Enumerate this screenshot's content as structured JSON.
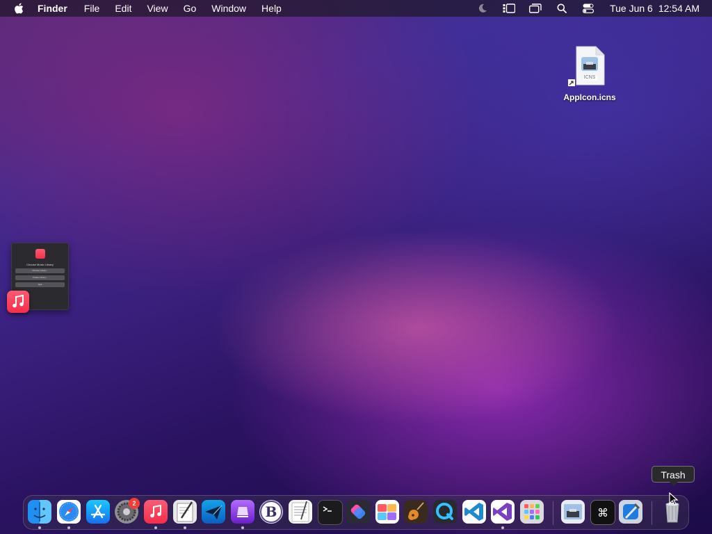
{
  "menubar": {
    "apple_icon": "apple-logo-icon",
    "app_name": "Finder",
    "menus": [
      "File",
      "Edit",
      "View",
      "Go",
      "Window",
      "Help"
    ],
    "status_icons": [
      "focus-moon-icon",
      "stage-manager-icon",
      "screen-mirroring-icon",
      "spotlight-search-icon",
      "control-center-icon"
    ],
    "clock": {
      "date": "Tue Jun 6",
      "time": "12:54 AM"
    }
  },
  "desktop": {
    "file": {
      "name": "AppIcon.icns",
      "badge": "ICNS",
      "alias": true
    }
  },
  "music_dialog_thumbnail": {
    "title": "Choose Music Library",
    "buttons": [
      "Choose Library...",
      "Create Library...",
      "Quit"
    ]
  },
  "dock": {
    "apps": [
      {
        "name": "Finder",
        "icon": "finder-icon",
        "running": true
      },
      {
        "name": "Safari",
        "icon": "safari-icon",
        "running": true
      },
      {
        "name": "App Store",
        "icon": "app-store-icon",
        "running": false
      },
      {
        "name": "System Settings",
        "icon": "settings-gear-icon",
        "running": false,
        "badge": "2"
      },
      {
        "name": "Music",
        "icon": "music-icon",
        "running": true
      },
      {
        "name": "Script Editor",
        "icon": "script-editor-icon",
        "running": true
      },
      {
        "name": "Mail Client",
        "icon": "paper-plane-icon",
        "running": false
      },
      {
        "name": "Archiver",
        "icon": "purple-app-icon",
        "running": true
      },
      {
        "name": "BBEdit",
        "icon": "bbedit-icon",
        "running": false
      },
      {
        "name": "TextEdit",
        "icon": "textedit-icon",
        "running": false
      },
      {
        "name": "Terminal",
        "icon": "terminal-icon",
        "running": false
      },
      {
        "name": "Shortcuts",
        "icon": "shortcuts-icon",
        "running": false
      },
      {
        "name": "Icon Composer",
        "icon": "icon-composer-icon",
        "running": false
      },
      {
        "name": "GarageBand",
        "icon": "guitar-icon",
        "running": false
      },
      {
        "name": "QuickTime Player",
        "icon": "quicktime-icon",
        "running": false
      },
      {
        "name": "Visual Studio Code",
        "icon": "vscode-icon",
        "running": false
      },
      {
        "name": "Visual Studio",
        "icon": "visual-studio-icon",
        "running": true
      },
      {
        "name": "Launchpad",
        "icon": "launchpad-icon",
        "running": false
      },
      {
        "name": "Image Viewer",
        "icon": "preview-icon",
        "running": false
      },
      {
        "name": "Keyboard Shortcuts",
        "icon": "command-key-icon",
        "running": false
      },
      {
        "name": "Xcode",
        "icon": "xcode-icon",
        "running": false
      },
      {
        "name": "Trash",
        "icon": "trash-icon",
        "running": false
      }
    ],
    "tooltip": "Trash"
  },
  "colors": {
    "menubar": "#1e1828",
    "badge_red": "#f43b35",
    "music_red": "#f72d48"
  }
}
